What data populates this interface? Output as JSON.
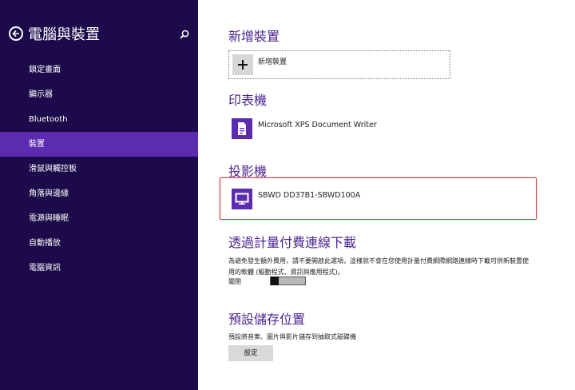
{
  "sidebar": {
    "title": "電腦與裝置",
    "items": [
      {
        "label": "鎖定畫面",
        "selected": false
      },
      {
        "label": "顯示器",
        "selected": false
      },
      {
        "label": "Bluetooth",
        "selected": false
      },
      {
        "label": "裝置",
        "selected": true
      },
      {
        "label": "滑鼠與觸控板",
        "selected": false
      },
      {
        "label": "角落與邊緣",
        "selected": false
      },
      {
        "label": "電源與睡眠",
        "selected": false
      },
      {
        "label": "自動播放",
        "selected": false
      },
      {
        "label": "電腦資訊",
        "selected": false
      }
    ]
  },
  "main": {
    "add_device": {
      "title": "新增裝置",
      "button_label": "新增裝置"
    },
    "printers": {
      "title": "印表機",
      "device_name": "Microsoft XPS Document Writer",
      "icon": "printer-document-icon"
    },
    "projectors": {
      "title": "投影機",
      "device_name": "SBWD DD37B1-SBWD100A",
      "icon": "monitor-icon"
    },
    "metered": {
      "title": "透過計量付費連線下載",
      "description": "為避免發生額外費用，請不要開啟此選項，這樣就不會在您使用計量付費網際網路連線時下載可供新裝置使用的軟體 (驅動程式、資訊與應用程式)。",
      "toggle_label": "關閉",
      "toggle_on": false
    },
    "storage": {
      "title": "預設儲存位置",
      "description": "預設將音樂、圖片與影片儲存到抽取式磁碟機",
      "button_label": "設定"
    }
  },
  "colors": {
    "sidebar_bg": "#1c0a4a",
    "selected_bg": "#5c2cb0",
    "heading": "#4a2391",
    "accent_tile": "#5c2cb0",
    "highlight_border": "#c04040"
  }
}
